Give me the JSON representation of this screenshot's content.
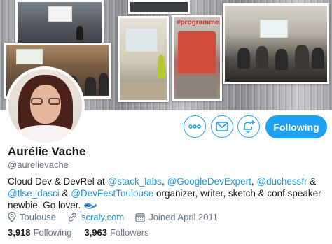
{
  "profile": {
    "name": "Aurélie Vache",
    "handle": "@aurelievache"
  },
  "bio": {
    "p1": "Cloud Dev & DevRel at ",
    "m1": "@stack_labs",
    "p2": ", ",
    "m2": "@GoogleDevExpert",
    "p3": ", ",
    "m3": "@duchessfr",
    "p4": " & ",
    "m4": "@tlse_dasci",
    "p5": " & ",
    "m5": "@DevFestToulouse",
    "p6": " organizer, writer, sketch & conf speaker newbie. Go lover. ",
    "emoji": "whale-icon"
  },
  "meta": {
    "location": "Toulouse",
    "website": "scraly.com",
    "joined": "Joined April 2011"
  },
  "stats": {
    "following_count": "3,918",
    "following_label": "Following",
    "followers_count": "3,963",
    "followers_label": "Followers"
  },
  "actions": {
    "follow_label": "Following",
    "more_icon": "more-icon",
    "message_icon": "envelope-icon",
    "notify_icon": "bell-plus-icon"
  },
  "banner": {
    "overlay_text": "#programmez"
  },
  "colors": {
    "accent": "#1da1f2",
    "link": "#1b95e0",
    "secondary_text": "#657786",
    "primary_text": "#14171a"
  }
}
